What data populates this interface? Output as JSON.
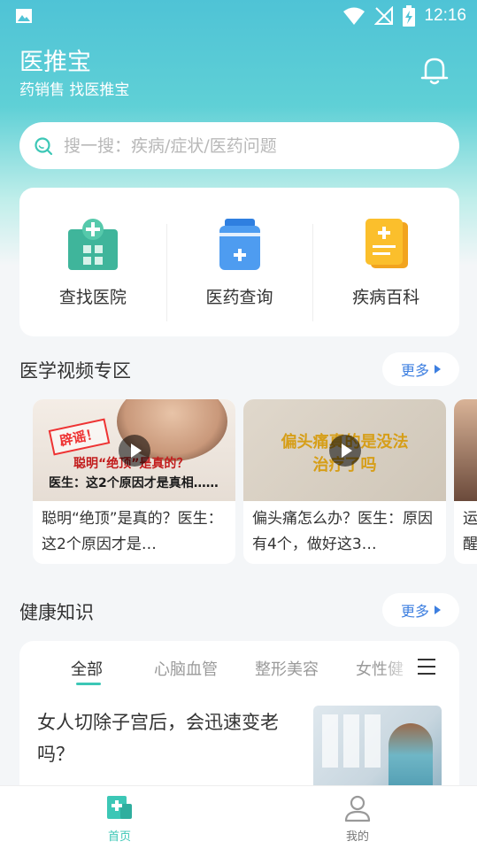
{
  "status_bar": {
    "time": "12:16"
  },
  "header": {
    "title": "医推宝",
    "subtitle": "药销售 找医推宝"
  },
  "search": {
    "placeholder": "搜一搜：疾病/症状/医药问题"
  },
  "quick_links": [
    {
      "label": "查找医院",
      "icon": "hospital-icon"
    },
    {
      "label": "医药查询",
      "icon": "medicine-icon"
    },
    {
      "label": "疾病百科",
      "icon": "encyclopedia-icon"
    }
  ],
  "video_section": {
    "title": "医学视频专区",
    "more_label": "更多",
    "videos": [
      {
        "title": "聪明“绝顶”是真的？医生：这2个原因才是…",
        "thumb_stamp": "辟谣！",
        "thumb_line1": "聪明“绝顶”是真的？",
        "thumb_line2": "医生：这2个原因才是真相……"
      },
      {
        "title": "偏头痛怎么办？医生：原因有4个，做好这3…",
        "thumb_line1": "偏头痛真的是没法",
        "thumb_line2": "治疗了吗"
      },
      {
        "title": "运醒"
      }
    ]
  },
  "health_section": {
    "title": "健康知识",
    "more_label": "更多",
    "tabs": [
      "全部",
      "心脑血管",
      "整形美容",
      "女性健"
    ],
    "article": {
      "title": "女人切除子宫后，会迅速变老吗？"
    }
  },
  "bottom_nav": [
    {
      "label": "首页",
      "active": true
    },
    {
      "label": "我的",
      "active": false
    }
  ],
  "colors": {
    "accent": "#3cc7b6",
    "link": "#3d7fe0",
    "header_gradient_top": "#4fc3d6"
  }
}
